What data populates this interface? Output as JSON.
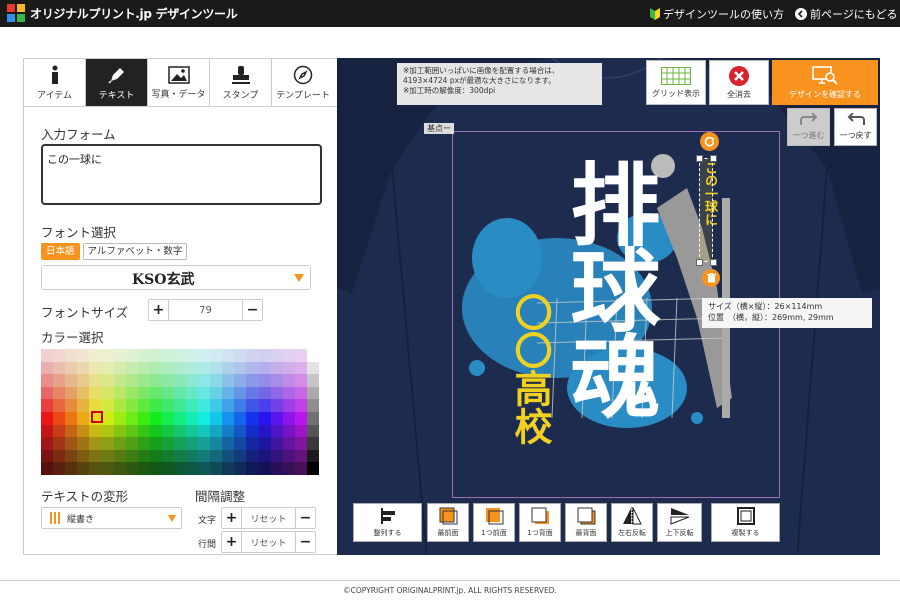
{
  "header": {
    "logo_text": "オリジナルプリント.jp デザインツール",
    "help_link": "デザインツールの使い方",
    "back_link": "前ページにもどる"
  },
  "tabs": [
    {
      "label": "アイテム",
      "icon": "info-icon"
    },
    {
      "label": "テキスト",
      "icon": "pen-icon",
      "active": true
    },
    {
      "label": "写真・データ",
      "icon": "image-icon"
    },
    {
      "label": "スタンプ",
      "icon": "stamp-icon"
    },
    {
      "label": "テンプレート",
      "icon": "compass-icon"
    }
  ],
  "text_panel": {
    "input_label": "入力フォーム",
    "input_value": "この一球に",
    "font_label": "フォント選択",
    "lang_japanese": "日本語",
    "lang_alpha": "アルファベット・数字",
    "font_value": "KSO玄武",
    "size_label": "フォントサイズ",
    "size_value": "79",
    "color_label": "カラー選択",
    "transform_label": "テキストの変形",
    "transform_value": "縦書き",
    "spacing_label": "間隔調整",
    "char_label": "文字",
    "line_label": "行間",
    "reset_label": "リセット"
  },
  "canvas": {
    "notice_lines": [
      "※加工範囲いっぱいに画像を配置する場合は、",
      "4193×4724 pxが最適な大きさになります。",
      "※加工時の解像度：300dpi"
    ],
    "baseline_tag": "基点ー",
    "grid_label": "グリッド表示",
    "clear_label": "全消去",
    "confirm_label": "デザインを確認する",
    "redo_label": "一つ進む",
    "undo_label": "一つ戻す",
    "design_main_text": "排球魂",
    "design_school_line1": "〇〇",
    "design_school_line2": "高校",
    "design_selected_text": "この一球に",
    "info_size": "サイズ（横×縦）：26×114mm",
    "info_pos": "位置　（横，縦）：269mm, 29mm",
    "bottom_buttons": [
      "整列する",
      "最前面",
      "1つ前面",
      "1つ背面",
      "最背面",
      "左右反転",
      "上下反転",
      "複製する"
    ],
    "accent_color": "#f7931e",
    "shirt_color": "#1d2b4f"
  },
  "footer": {
    "copyright": "©COPYRIGHT ORIGINALPRINT.jp. ALL RIGHTS RESERVED."
  }
}
